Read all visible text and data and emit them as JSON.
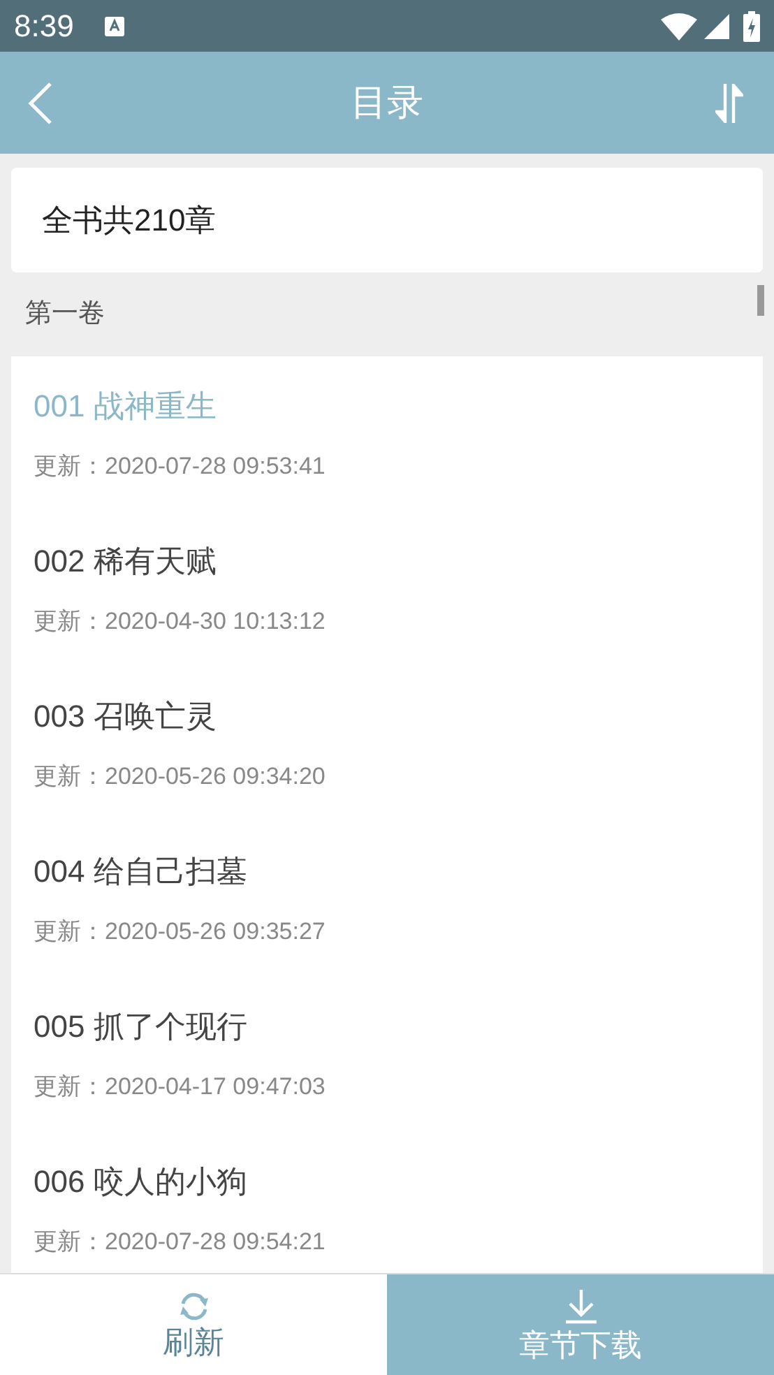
{
  "status_bar": {
    "time": "8:39"
  },
  "app_bar": {
    "title": "目录"
  },
  "summary": "全书共210章",
  "volume": {
    "title": "第一卷",
    "chapters": [
      {
        "title": "001 战神重生",
        "updated": "更新：2020-07-28 09:53:41",
        "selected": true
      },
      {
        "title": "002 稀有天赋",
        "updated": "更新：2020-04-30 10:13:12",
        "selected": false
      },
      {
        "title": "003 召唤亡灵",
        "updated": "更新：2020-05-26 09:34:20",
        "selected": false
      },
      {
        "title": "004 给自己扫墓",
        "updated": "更新：2020-05-26 09:35:27",
        "selected": false
      },
      {
        "title": "005 抓了个现行",
        "updated": "更新：2020-04-17 09:47:03",
        "selected": false
      },
      {
        "title": "006 咬人的小狗",
        "updated": "更新：2020-07-28 09:54:21",
        "selected": false
      }
    ]
  },
  "bottom_bar": [
    {
      "label": "刷新",
      "kind": "refresh"
    },
    {
      "label": "章节下载",
      "kind": "download"
    }
  ]
}
